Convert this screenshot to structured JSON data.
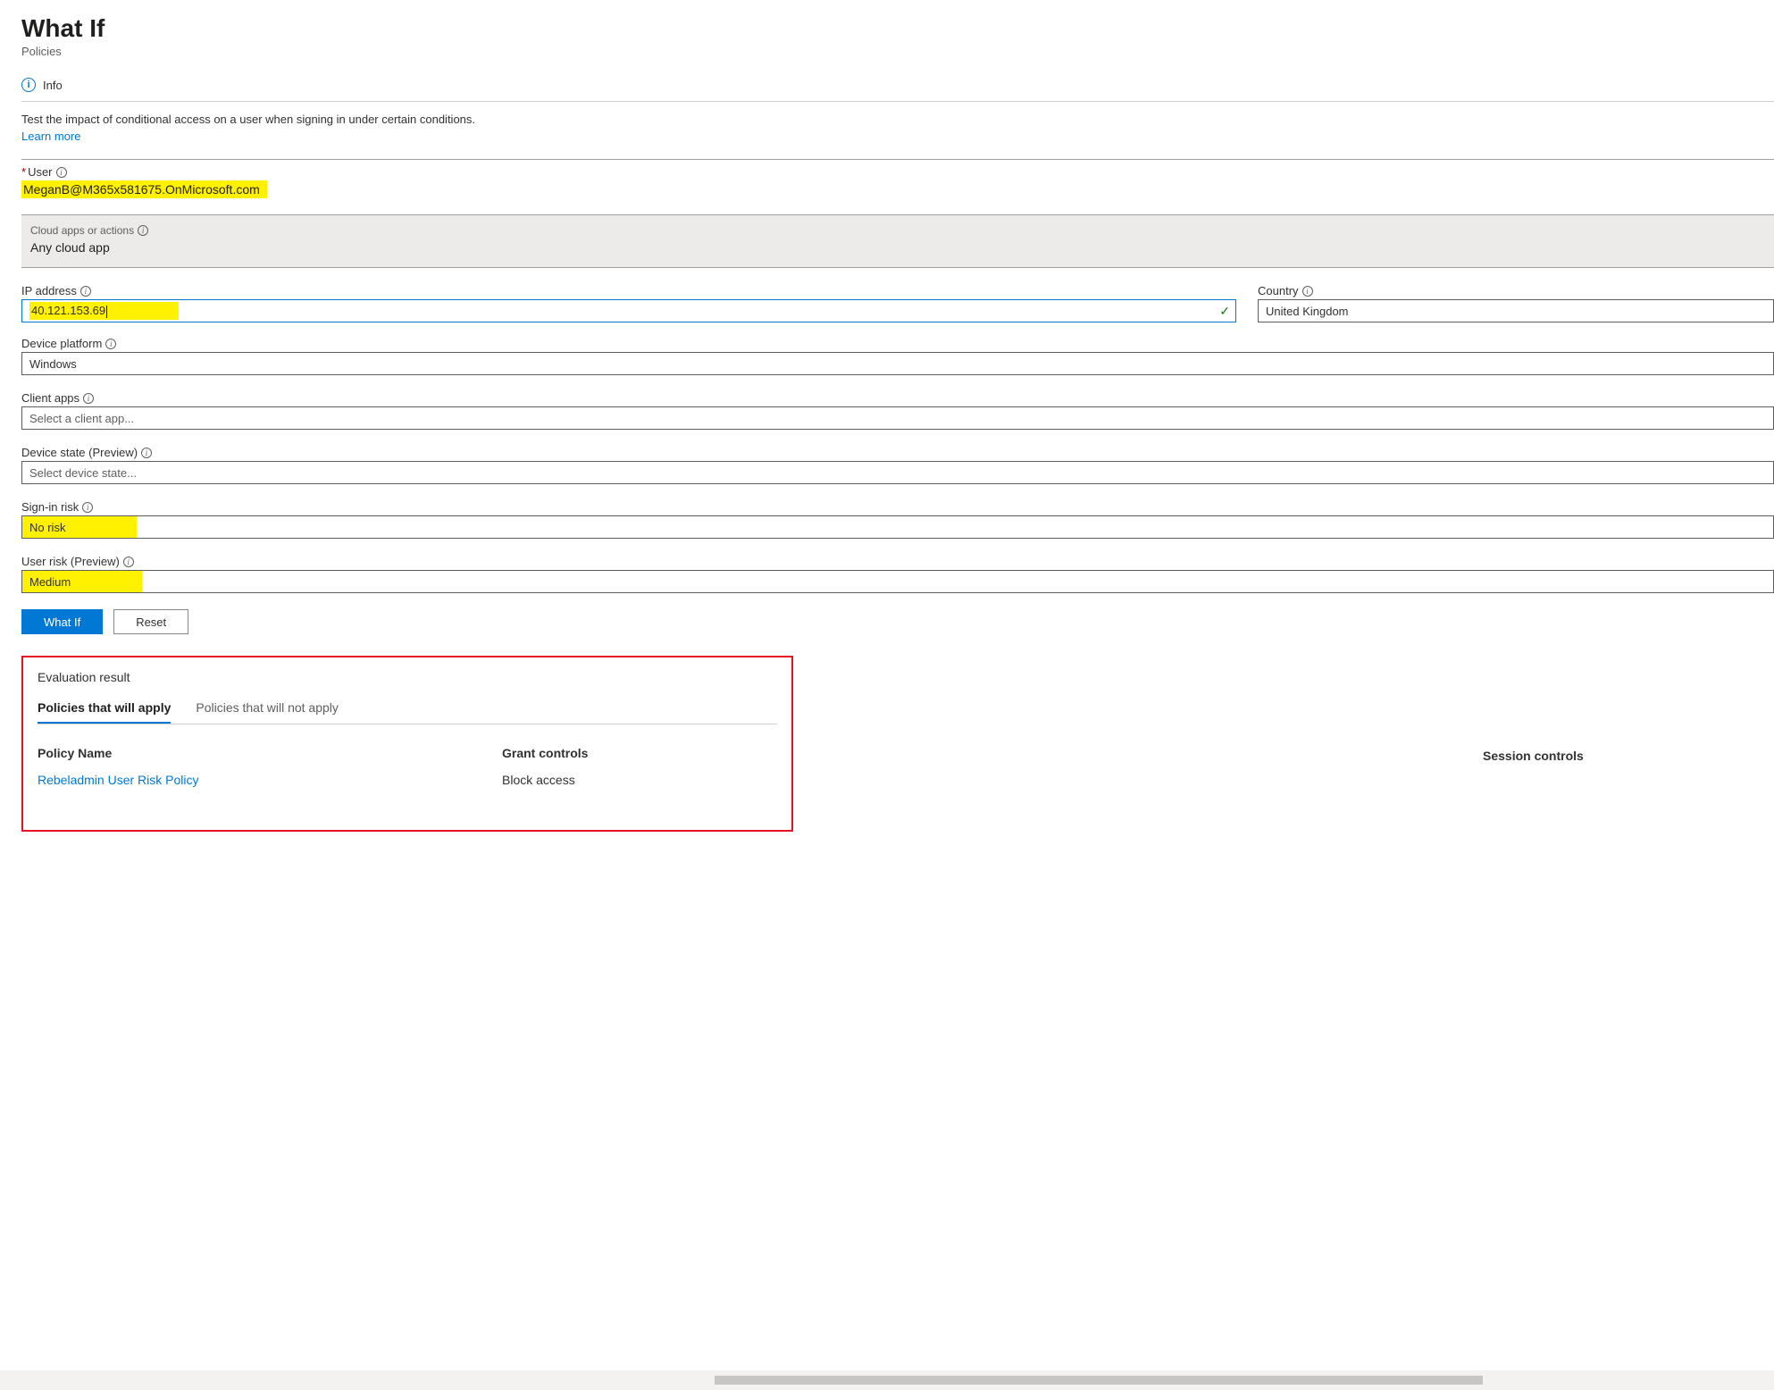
{
  "header": {
    "title": "What If",
    "breadcrumb": "Policies"
  },
  "commandbar": {
    "info_label": "Info"
  },
  "intro": {
    "text": "Test the impact of conditional access on a user when signing in under certain conditions.",
    "learn_more": "Learn more"
  },
  "fields": {
    "user": {
      "label": "User",
      "value": "MeganB@M365x581675.OnMicrosoft.com"
    },
    "cloud_apps": {
      "label": "Cloud apps or actions",
      "value": "Any cloud app"
    },
    "ip_address": {
      "label": "IP address",
      "value": "40.121.153.69"
    },
    "country": {
      "label": "Country",
      "value": "United Kingdom"
    },
    "device_platform": {
      "label": "Device platform",
      "value": "Windows"
    },
    "client_apps": {
      "label": "Client apps",
      "placeholder": "Select a client app..."
    },
    "device_state": {
      "label": "Device state (Preview)",
      "placeholder": "Select device state..."
    },
    "signin_risk": {
      "label": "Sign-in risk",
      "value": "No risk"
    },
    "user_risk": {
      "label": "User risk (Preview)",
      "value": "Medium"
    }
  },
  "buttons": {
    "whatif": "What If",
    "reset": "Reset"
  },
  "result": {
    "title": "Evaluation result",
    "tabs": {
      "apply": "Policies that will apply",
      "not_apply": "Policies that will not apply"
    },
    "columns": {
      "policy_name": "Policy Name",
      "grant_controls": "Grant controls",
      "session_controls": "Session controls"
    },
    "rows": [
      {
        "policy_name": "Rebeladmin User Risk Policy",
        "grant_controls": "Block access"
      }
    ]
  }
}
